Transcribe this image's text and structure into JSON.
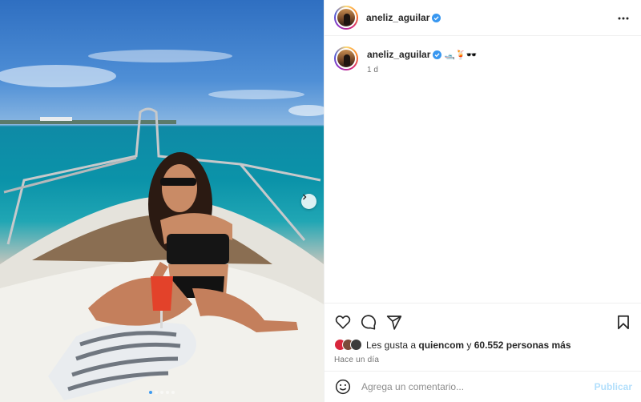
{
  "post": {
    "username": "aneliz_aguilar",
    "caption_emojis": "🛥️🍹🕶️",
    "caption_time": "1 d",
    "image_alt": "Woman in black swimsuit and sunglasses sitting on a boat deck holding a drink, turquoise sea behind",
    "carousel_count": 5,
    "carousel_active": 0
  },
  "actions": {
    "like_icon": "heart-icon",
    "comment_icon": "comment-icon",
    "share_icon": "paper-plane-icon",
    "save_icon": "bookmark-icon"
  },
  "likes": {
    "prefix": "Les gusta a",
    "user": "quiencom",
    "connector": "y",
    "others": "60.552 personas más"
  },
  "posted_ago": "Hace un día",
  "comment_box": {
    "placeholder": "Agrega un comentario...",
    "publish_label": "Publicar"
  },
  "colors": {
    "verified": "#3897f0",
    "publish_disabled": "#b2dffc",
    "active_dot": "#3d9bf0"
  }
}
